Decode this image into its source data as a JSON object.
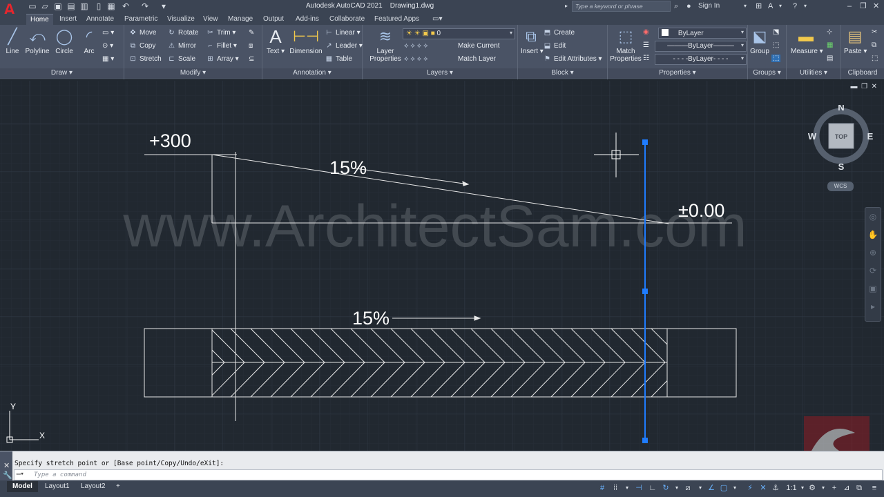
{
  "app": {
    "title": "Autodesk AutoCAD 2021",
    "file": "Drawing1.dwg",
    "logo_letter": "A"
  },
  "search": {
    "placeholder": "Type a keyword or phrase"
  },
  "account": {
    "sign_in": "Sign In"
  },
  "tabs": [
    "Home",
    "Insert",
    "Annotate",
    "Parametric",
    "Visualize",
    "View",
    "Manage",
    "Output",
    "Add-ins",
    "Collaborate",
    "Featured Apps"
  ],
  "ribbon": {
    "draw": {
      "title": "Draw",
      "line": "Line",
      "polyline": "Polyline",
      "circle": "Circle",
      "arc": "Arc"
    },
    "modify": {
      "title": "Modify",
      "move": "Move",
      "rotate": "Rotate",
      "trim": "Trim",
      "copy": "Copy",
      "mirror": "Mirror",
      "fillet": "Fillet",
      "stretch": "Stretch",
      "scale": "Scale",
      "array": "Array"
    },
    "annotation": {
      "title": "Annotation",
      "text": "Text",
      "dimension": "Dimension",
      "linear": "Linear",
      "leader": "Leader",
      "table": "Table"
    },
    "layers": {
      "title": "Layers",
      "layer_properties": "Layer Properties",
      "current_layer": "0",
      "make_current": "Make Current",
      "match_layer": "Match Layer"
    },
    "block": {
      "title": "Block",
      "insert": "Insert",
      "create": "Create",
      "edit": "Edit",
      "edit_attributes": "Edit Attributes"
    },
    "properties": {
      "title": "Properties",
      "match_properties": "Match Properties",
      "color": "ByLayer",
      "linetype": "ByLayer",
      "lineweight": "ByLayer"
    },
    "groups": {
      "title": "Groups",
      "group": "Group"
    },
    "utilities": {
      "title": "Utilities",
      "measure": "Measure"
    },
    "clipboard": {
      "title": "Clipboard",
      "paste": "Paste"
    }
  },
  "drawing": {
    "level_top": "+300",
    "level_zero": "±0.00",
    "slope_upper": "15%",
    "slope_lower": "15%",
    "watermark": "www.ArchitectSam.com"
  },
  "viewcube": {
    "north": "N",
    "south": "S",
    "east": "E",
    "west": "W",
    "face": "TOP",
    "wcs": "WCS"
  },
  "ucs": {
    "x": "X",
    "y": "Y"
  },
  "command": {
    "history": "Specify stretch point or [Base point/Copy/Undo/eXit]:",
    "placeholder": "Type a command"
  },
  "layouts": [
    "Model",
    "Layout1",
    "Layout2"
  ],
  "status": {
    "scale": "1:1"
  },
  "colors": {
    "accent": "#1f7cff",
    "canvas": "#212830",
    "ribbon": "#4a5365",
    "titlebar": "#3b4453",
    "logo": "#e8262d"
  }
}
